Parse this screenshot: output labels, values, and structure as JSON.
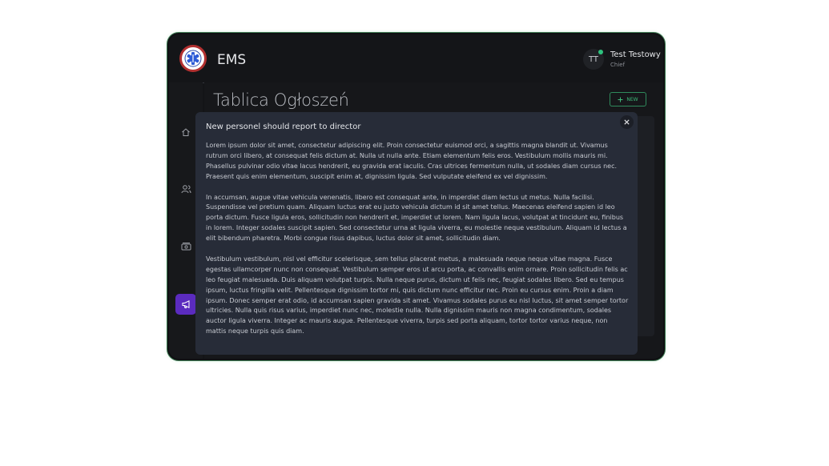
{
  "header": {
    "app_title": "EMS",
    "user_initials": "TT",
    "user_name": "Test Testowy",
    "user_role": "Chief"
  },
  "sidebar": {
    "items": [
      {
        "icon": "home-icon"
      },
      {
        "icon": "users-icon"
      },
      {
        "icon": "money-icon"
      },
      {
        "icon": "megaphone-icon",
        "active": true
      }
    ]
  },
  "main": {
    "page_title": "Tablica Ogłoszeń",
    "new_button_label": "NEW"
  },
  "modal": {
    "title": "New personel should report to director",
    "paragraphs": [
      "Lorem ipsum dolor sit amet, consectetur adipiscing elit. Proin consectetur euismod orci, a sagittis magna blandit ut. Vivamus rutrum orci libero, at consequat felis dictum at. Nulla ut nulla ante. Etiam elementum felis eros. Vestibulum mollis mauris mi. Phasellus pulvinar odio vitae lacus hendrerit, eu gravida erat iaculis. Cras ultrices fermentum nulla, ut sodales diam cursus nec. Praesent quis enim elementum, suscipit enim at, dignissim ligula. Sed vulputate eleifend ex vel dignissim.",
      "In accumsan, augue vitae vehicula venenatis, libero est consequat ante, in imperdiet diam lectus ut metus. Nulla facilisi. Suspendisse vel pretium quam. Aliquam luctus erat eu justo vehicula dictum id sit amet tellus. Maecenas eleifend sapien id leo porta dictum. Fusce ligula eros, sollicitudin non hendrerit et, imperdiet ut lorem. Nam ligula lacus, volutpat at tincidunt eu, finibus in lorem. Integer sodales suscipit sapien. Sed consectetur urna at ligula viverra, eu molestie neque vestibulum. Aliquam id lectus a elit bibendum pharetra. Morbi congue risus dapibus, luctus dolor sit amet, sollicitudin diam.",
      "Vestibulum vestibulum, nisl vel efficitur scelerisque, sem tellus placerat metus, a malesuada neque neque vitae magna. Fusce egestas ullamcorper nunc non consequat. Vestibulum semper eros ut arcu porta, ac convallis enim ornare. Proin sollicitudin felis ac leo feugiat malesuada. Duis aliquam volutpat turpis. Nulla neque purus, dictum ut felis nec, feugiat sodales libero. Sed eu tempus ipsum, luctus fringilla velit. Pellentesque dignissim tortor mi, quis dictum nunc efficitur nec. Proin eu cursus enim. Proin a diam ipsum. Donec semper erat odio, id accumsan sapien gravida sit amet. Vivamus sodales purus eu nisl luctus, sit amet semper tortor ultricies. Nulla quis risus varius, imperdiet nunc nec, molestie nulla. Nulla dignissim mauris non magna condimentum, sodales auctor ligula viverra. Integer ac mauris augue. Pellentesque viverra, turpis sed porta aliquam, tortor tortor varius neque, non mattis neque turpis quis diam."
    ]
  },
  "colors": {
    "accent_purple": "#5b2bbf",
    "success_green": "#2ec27e",
    "modal_bg": "#272c38"
  }
}
